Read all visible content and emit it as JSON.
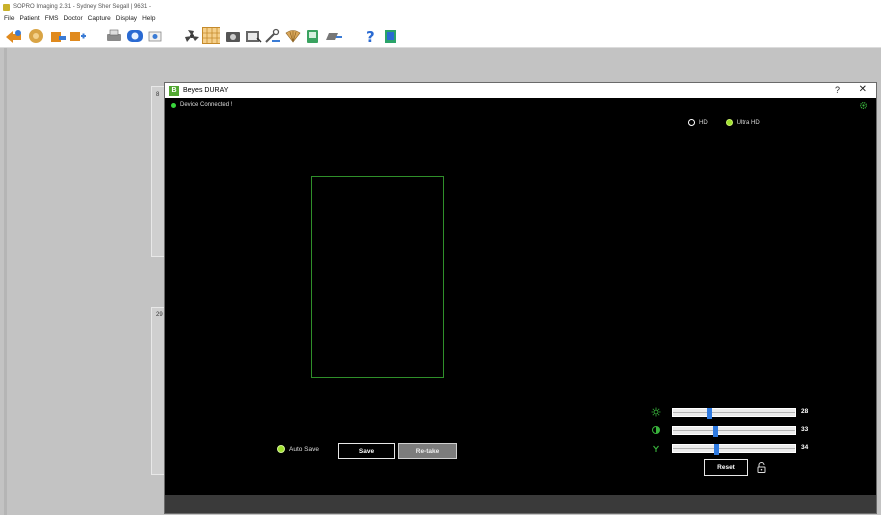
{
  "app": {
    "title": "SOPRO Imaging 2.31 -   Sydney Sher Segall | 9631 -",
    "menu": [
      "File",
      "Patient",
      "FMS",
      "Doctor",
      "Capture",
      "Display",
      "Help"
    ]
  },
  "toolbar": {
    "icons": [
      "patient-back-icon",
      "patient-folder-icon",
      "patient-export-icon",
      "add-patient-icon",
      "print-icon",
      "dicom-icon",
      "settings-icon",
      "fan-icon",
      "fms-grid-icon",
      "camera-icon",
      "image-import-icon",
      "tools-icon",
      "shell-icon",
      "scanner-icon",
      "export-icon",
      "help-icon",
      "exit-icon"
    ]
  },
  "background": {
    "label_top": "8",
    "label_bottom": "29"
  },
  "dialog": {
    "title": "Beyes DURAY",
    "logo": "B",
    "help": "?",
    "close": "✕",
    "status": "Device Connected !",
    "resolution": {
      "hd_label": "HD",
      "ultra_label": "Ultra HD",
      "selected": "Ultra HD"
    },
    "auto_save_label": "Auto Save",
    "save_label": "Save",
    "retake_label": "Re-take",
    "reset_label": "Reset",
    "sliders": [
      {
        "name": "brightness",
        "icon": "brightness-icon",
        "value": 28,
        "level": 0.28
      },
      {
        "name": "contrast",
        "icon": "contrast-icon",
        "value": 33,
        "level": 0.33
      },
      {
        "name": "gamma",
        "icon": "gamma-icon",
        "value": 34,
        "level": 0.34
      }
    ]
  },
  "colors": {
    "accent_green": "#9ee02c",
    "status_green": "#39d63c",
    "slider_thumb": "#2f7ae0",
    "dialog_bg": "#000000",
    "frame_green": "#2f8f2a"
  }
}
